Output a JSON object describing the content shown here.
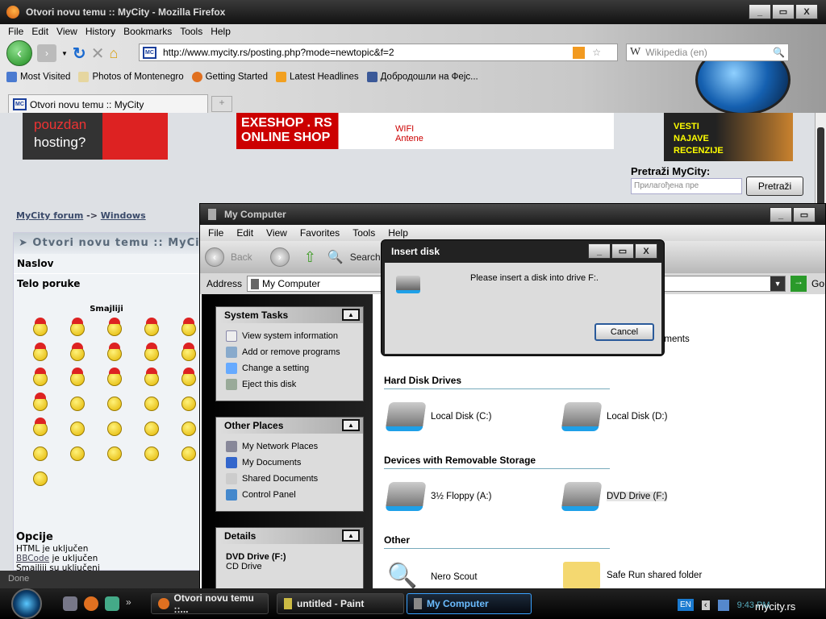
{
  "firefox": {
    "title": "Otvori novu temu :: MyCity - Mozilla Firefox",
    "menu": [
      "File",
      "Edit",
      "View",
      "History",
      "Bookmarks",
      "Tools",
      "Help"
    ],
    "url": "http://www.mycity.rs/posting.php?mode=newtopic&f=2",
    "search_placeholder": "Wikipedia (en)",
    "bookmarks": [
      "Most Visited",
      "Photos of Montenegro",
      "Getting Started",
      "Latest Headlines",
      "Добродошли на Фејс..."
    ],
    "tab": "Otvori novu temu :: MyCity",
    "favicon": "MC",
    "status": "Done"
  },
  "page": {
    "ad1": [
      "pouzdan",
      "hosting?"
    ],
    "ad2": {
      "title": "EXESHOP . RS",
      "sub": "ONLINE SHOP",
      "wifi": "WIFI",
      "antene": "Antene"
    },
    "ad3": [
      "VESTI",
      "NAJAVE",
      "RECENZIJE"
    ],
    "search_label": "Pretraži MyCity:",
    "search_placeholder": "Прилагођена пре",
    "search_button": "Pretraži",
    "breadcrumb": {
      "home": "MyCity forum",
      "sep": "->",
      "current": "Windows"
    },
    "header": "Otvori novu temu :: MyCity",
    "naslov": "Naslov",
    "telo": "Telo poruke",
    "smilies_title": "Smajliji",
    "smilies_count": 31,
    "options_title": "Opcije",
    "options": {
      "html": "HTML je uključen",
      "bbcode_link": "BBCode",
      "bbcode_rest": " je uključen",
      "smilies": "Smailiji su uključeni"
    }
  },
  "mycomputer": {
    "title": "My Computer",
    "menu": [
      "File",
      "Edit",
      "View",
      "Favorites",
      "Tools",
      "Help"
    ],
    "back": "Back",
    "search": "Search",
    "address_label": "Address",
    "address": "My Computer",
    "go": "Go",
    "system_tasks": {
      "title": "System Tasks",
      "items": [
        "View system information",
        "Add or remove programs",
        "Change a setting",
        "Eject this disk"
      ]
    },
    "other_places": {
      "title": "Other Places",
      "items": [
        "My Network Places",
        "My Documents",
        "Shared Documents",
        "Control Panel"
      ]
    },
    "details": {
      "title": "Details",
      "name": "DVD Drive (F:)",
      "type": "CD Drive"
    },
    "partial_item": "uments",
    "sections": {
      "hdd": "Hard Disk Drives",
      "removable": "Devices with Removable Storage",
      "other": "Other"
    },
    "hdd": [
      "Local Disk (C:)",
      "Local Disk (D:)"
    ],
    "removable": [
      "3½ Floppy (A:)",
      "DVD Drive (F:)"
    ],
    "other": [
      "Nero Scout",
      "Safe Run shared folder"
    ]
  },
  "dialog": {
    "title": "Insert disk",
    "message": "Please insert a disk into drive F:.",
    "cancel": "Cancel"
  },
  "taskbar": {
    "tasks": [
      "Otvori novu temu ::...",
      "untitled - Paint",
      "My Computer"
    ],
    "lang": "EN",
    "clock": "9:43 PM",
    "watermark": "mycity.rs",
    "chevron": "»"
  }
}
